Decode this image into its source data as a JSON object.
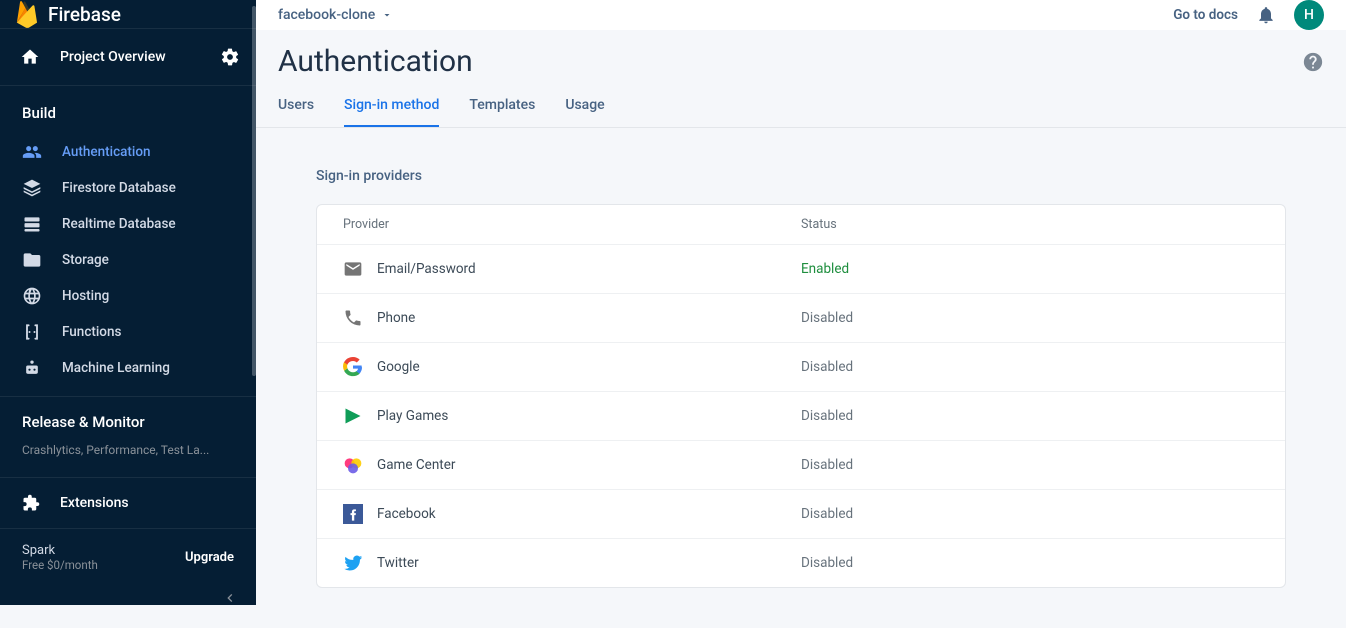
{
  "brand": {
    "name": "Firebase"
  },
  "overview": {
    "label": "Project Overview"
  },
  "sidebar": {
    "build_header": "Build",
    "items": [
      {
        "label": "Authentication",
        "icon": "people-icon",
        "active": true
      },
      {
        "label": "Firestore Database",
        "icon": "layers-icon"
      },
      {
        "label": "Realtime Database",
        "icon": "database-icon"
      },
      {
        "label": "Storage",
        "icon": "folder-icon"
      },
      {
        "label": "Hosting",
        "icon": "globe-icon"
      },
      {
        "label": "Functions",
        "icon": "functions-icon"
      },
      {
        "label": "Machine Learning",
        "icon": "robot-icon"
      }
    ],
    "release_header": "Release & Monitor",
    "release_sub": "Crashlytics, Performance, Test La...",
    "extensions": "Extensions",
    "plan_name": "Spark",
    "plan_sub": "Free $0/month",
    "upgrade": "Upgrade"
  },
  "header": {
    "project": "facebook-clone",
    "docs": "Go to docs",
    "avatar_initial": "H"
  },
  "page": {
    "title": "Authentication",
    "tabs": [
      {
        "label": "Users"
      },
      {
        "label": "Sign-in method",
        "active": true
      },
      {
        "label": "Templates"
      },
      {
        "label": "Usage"
      }
    ],
    "section_label": "Sign-in providers",
    "table": {
      "col_provider": "Provider",
      "col_status": "Status"
    },
    "providers": [
      {
        "name": "Email/Password",
        "status": "Enabled",
        "enabled": true,
        "icon": "email"
      },
      {
        "name": "Phone",
        "status": "Disabled",
        "enabled": false,
        "icon": "phone"
      },
      {
        "name": "Google",
        "status": "Disabled",
        "enabled": false,
        "icon": "google"
      },
      {
        "name": "Play Games",
        "status": "Disabled",
        "enabled": false,
        "icon": "play"
      },
      {
        "name": "Game Center",
        "status": "Disabled",
        "enabled": false,
        "icon": "gamecenter"
      },
      {
        "name": "Facebook",
        "status": "Disabled",
        "enabled": false,
        "icon": "facebook"
      },
      {
        "name": "Twitter",
        "status": "Disabled",
        "enabled": false,
        "icon": "twitter"
      }
    ]
  }
}
